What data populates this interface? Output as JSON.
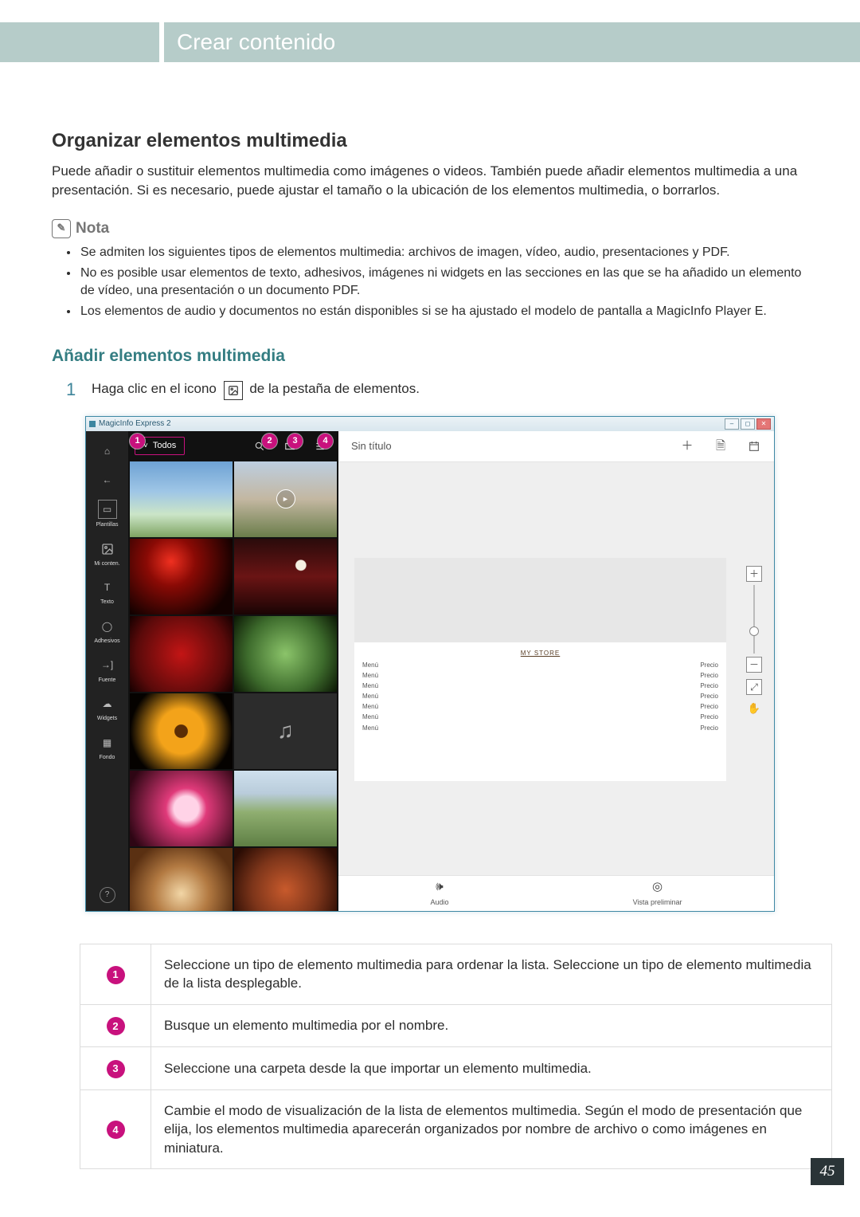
{
  "page_number": "45",
  "header": {
    "section": "Crear contenido"
  },
  "headings": {
    "h2": "Organizar elementos multimedia",
    "h3": "Añadir elementos multimedia"
  },
  "intro": "Puede añadir o sustituir elementos multimedia como imágenes o videos. También puede añadir elementos multimedia a una presentación. Si es necesario, puede ajustar el tamaño o la ubicación de los elementos multimedia, o borrarlos.",
  "note": {
    "title": "Nota",
    "items": [
      "Se admiten los siguientes tipos de elementos multimedia: archivos de imagen, vídeo, audio, presentaciones y PDF.",
      "No es posible usar elementos de texto, adhesivos, imágenes ni widgets en las secciones en las que se ha añadido un elemento de vídeo, una presentación o un documento PDF.",
      "Los elementos de audio y documentos no están disponibles si se ha ajustado el modelo de pantalla a MagicInfo Player E."
    ]
  },
  "step": {
    "num": "1",
    "pre": "Haga clic en el icono",
    "post": "de la pestaña de elementos."
  },
  "app": {
    "title": "MagicInfo Express 2",
    "filter": "Todos",
    "canvas_title": "Sin título",
    "store_title": "MY STORE",
    "menu_label": "Menú",
    "price_label": "Precio",
    "bottom_audio": "Audio",
    "bottom_preview": "Vista preliminar",
    "leftnav": [
      {
        "label": "",
        "icon": "home"
      },
      {
        "label": "",
        "icon": "back"
      },
      {
        "label": "Plantillas",
        "icon": "templates"
      },
      {
        "label": "Mi conten.",
        "icon": "image"
      },
      {
        "label": "Texto",
        "icon": "text"
      },
      {
        "label": "Adhesivos",
        "icon": "sticker"
      },
      {
        "label": "Fuente",
        "icon": "source"
      },
      {
        "label": "Widgets",
        "icon": "widget"
      },
      {
        "label": "Fondo",
        "icon": "bg"
      }
    ]
  },
  "legend": {
    "1": "Seleccione un tipo de elemento multimedia para ordenar la lista. Seleccione un tipo de elemento multimedia de la lista desplegable.",
    "2": "Busque un elemento multimedia por el nombre.",
    "3": "Seleccione una carpeta desde la que importar un elemento multimedia.",
    "4": "Cambie el modo de visualización de la lista de elementos multimedia. Según el modo de presentación que elija, los elementos multimedia aparecerán organizados por nombre de archivo o como imágenes en miniatura."
  }
}
